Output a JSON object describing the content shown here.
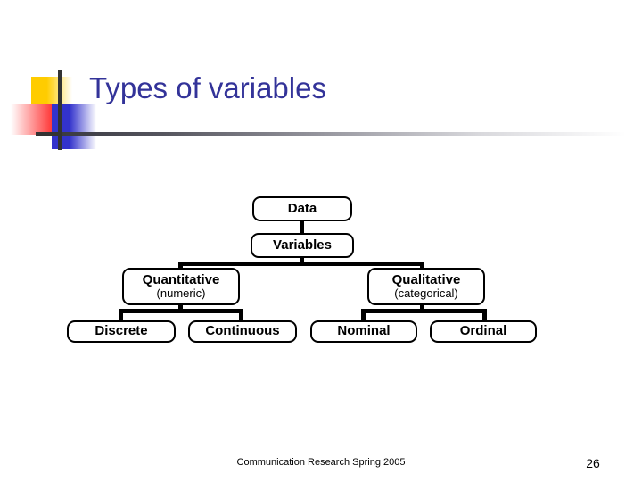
{
  "slide": {
    "title": "Types of variables",
    "title_color": "#333399",
    "background": "#ffffff"
  },
  "decoration": {
    "yellow_color": "#FFCC00",
    "red_color": "#FF3333",
    "blue_color": "#3333CC",
    "line_color": "#333333",
    "rule_color": "#3a3a42"
  },
  "diagram": {
    "type": "tree",
    "nodes": {
      "data": {
        "main": "Data",
        "sub": ""
      },
      "variables": {
        "main": "Variables",
        "sub": ""
      },
      "quantitative": {
        "main": "Quantitative",
        "sub": "(numeric)"
      },
      "qualitative": {
        "main": "Qualitative",
        "sub": "(categorical)"
      },
      "discrete": {
        "main": "Discrete",
        "sub": ""
      },
      "continuous": {
        "main": "Continuous",
        "sub": ""
      },
      "nominal": {
        "main": "Nominal",
        "sub": ""
      },
      "ordinal": {
        "main": "Ordinal",
        "sub": ""
      }
    },
    "edges": [
      {
        "from": "data",
        "to": "variables"
      },
      {
        "from": "variables",
        "to": "quantitative"
      },
      {
        "from": "variables",
        "to": "qualitative"
      },
      {
        "from": "quantitative",
        "to": "discrete"
      },
      {
        "from": "quantitative",
        "to": "continuous"
      },
      {
        "from": "qualitative",
        "to": "nominal"
      },
      {
        "from": "qualitative",
        "to": "ordinal"
      }
    ]
  },
  "footer": {
    "text": "Communication Research Spring 2005",
    "page_number": "26"
  }
}
